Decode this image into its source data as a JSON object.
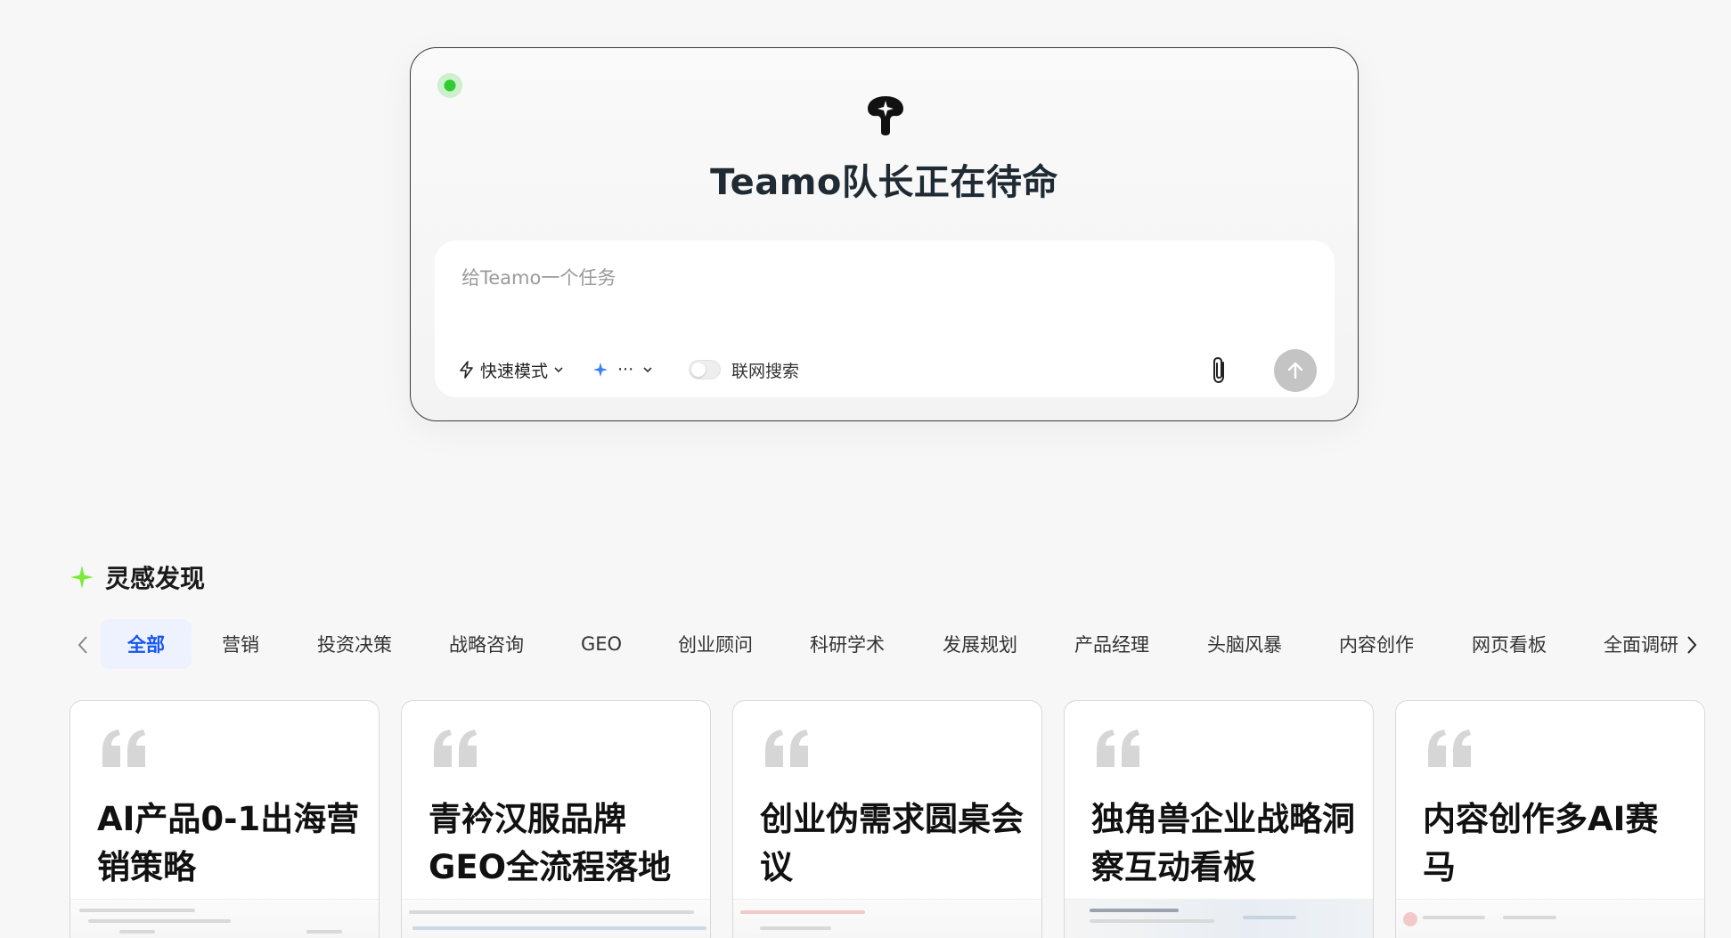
{
  "composer": {
    "title": "Teamo队长正在待命",
    "input_placeholder": "给Teamo一个任务",
    "mode_label": "快速模式",
    "model_label": "···",
    "web_search_label": "联网搜索",
    "web_search_enabled": false,
    "status_color": "#2ecc2e"
  },
  "inspiration": {
    "title": "灵感发现",
    "icon_color": "#7bea3a",
    "tabs": [
      {
        "label": "全部",
        "active": true
      },
      {
        "label": "营销",
        "active": false
      },
      {
        "label": "投资决策",
        "active": false
      },
      {
        "label": "战略咨询",
        "active": false
      },
      {
        "label": "GEO",
        "active": false
      },
      {
        "label": "创业顾问",
        "active": false
      },
      {
        "label": "科研学术",
        "active": false
      },
      {
        "label": "发展规划",
        "active": false
      },
      {
        "label": "产品经理",
        "active": false
      },
      {
        "label": "头脑风暴",
        "active": false
      },
      {
        "label": "内容创作",
        "active": false
      },
      {
        "label": "网页看板",
        "active": false
      },
      {
        "label": "全面调研",
        "active": false
      }
    ],
    "cards": [
      {
        "title": "AI产品0-1出海营销策略"
      },
      {
        "title": "青衿汉服品牌GEO全流程落地"
      },
      {
        "title": "创业伪需求圆桌会议"
      },
      {
        "title": "独角兽企业战略洞察互动看板"
      },
      {
        "title": "内容创作多AI赛马"
      }
    ]
  },
  "colors": {
    "accent": "#1456f0",
    "active_tab_bg": "#eef2ff",
    "send_button": "#c4c4c4"
  }
}
